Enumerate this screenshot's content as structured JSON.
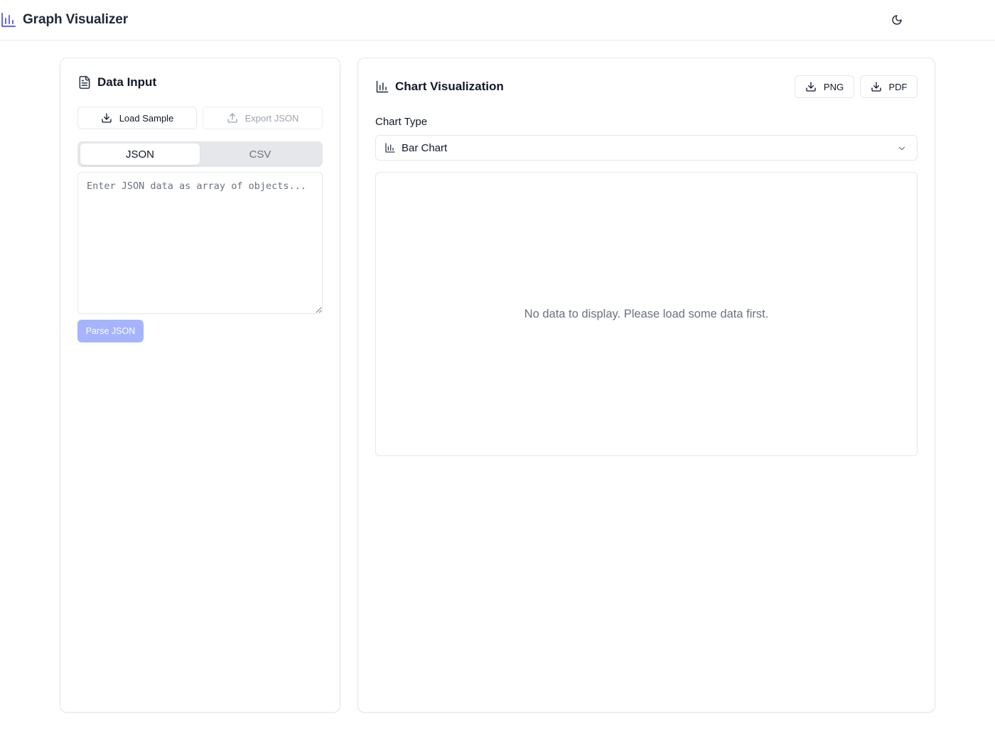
{
  "app": {
    "title": "Graph Visualizer",
    "brand_icon": "bar-chart-icon",
    "theme_toggle_icon": "moon-icon",
    "accent_color": "#6366f1"
  },
  "data_input": {
    "title": "Data Input",
    "title_icon": "file-text-icon",
    "load_sample_label": "Load Sample",
    "export_json_label": "Export JSON",
    "tabs": [
      {
        "label": "JSON",
        "active": true
      },
      {
        "label": "CSV",
        "active": false
      }
    ],
    "textarea": {
      "value": "",
      "placeholder": "Enter JSON data as array of objects..."
    },
    "parse_button_label": "Parse JSON"
  },
  "chart_panel": {
    "title": "Chart Visualization",
    "title_icon": "bar-chart-icon",
    "export_png_label": "PNG",
    "export_pdf_label": "PDF",
    "chart_type_label": "Chart Type",
    "chart_type_selected": "Bar Chart",
    "empty_message": "No data to display. Please load some data first."
  }
}
